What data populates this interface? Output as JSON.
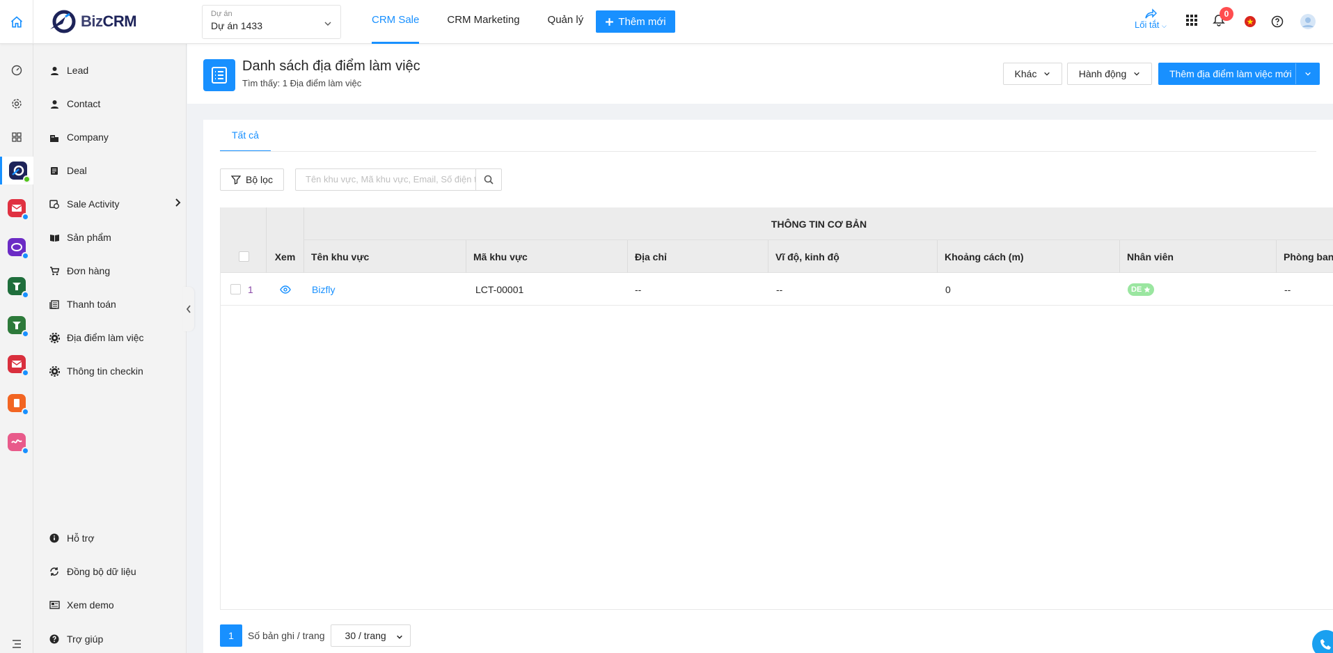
{
  "app": {
    "logo_prefix": "Biz",
    "logo_suffix": "CRM"
  },
  "project": {
    "label": "Dự án",
    "value": "Dự án 1433"
  },
  "topnav": {
    "tabs": [
      {
        "label": "CRM Sale",
        "active": true
      },
      {
        "label": "CRM Marketing",
        "active": false
      },
      {
        "label": "Quản lý",
        "active": false
      }
    ],
    "add_new_label": "Thêm mới",
    "shortcut_label": "Lối tắt",
    "notification_count": "0"
  },
  "sidebar": {
    "items": [
      {
        "label": "Lead",
        "icon": "user-icon"
      },
      {
        "label": "Contact",
        "icon": "user-icon"
      },
      {
        "label": "Company",
        "icon": "building-icon"
      },
      {
        "label": "Deal",
        "icon": "document-icon"
      },
      {
        "label": "Sale Activity",
        "icon": "calendar-clock-icon"
      },
      {
        "label": "Sản phẩm",
        "icon": "book-icon"
      },
      {
        "label": "Đơn hàng",
        "icon": "cart-icon"
      },
      {
        "label": "Thanh toán",
        "icon": "receipt-icon"
      },
      {
        "label": "Địa điểm làm việc",
        "icon": "gear-icon"
      },
      {
        "label": "Thông tin checkin",
        "icon": "gear-icon"
      }
    ],
    "bottom_items": [
      {
        "label": "Hỗ trợ",
        "icon": "info-icon"
      },
      {
        "label": "Đồng bộ dữ liệu",
        "icon": "sync-icon"
      },
      {
        "label": "Xem demo",
        "icon": "newspaper-icon"
      },
      {
        "label": "Trợ giúp",
        "icon": "help-icon"
      }
    ]
  },
  "page": {
    "title": "Danh sách địa điểm làm việc",
    "subtitle": "Tìm thấy: 1 Địa điểm làm việc",
    "btn_other": "Khác",
    "btn_action": "Hành động",
    "btn_add": "Thêm địa điểm làm việc mới"
  },
  "tabs": {
    "all": "Tất cả"
  },
  "filter": {
    "button": "Bộ lọc",
    "search_placeholder": "Tên khu vực, Mã khu vực, Email, Số điện thoại"
  },
  "table": {
    "group_header": "THÔNG TIN CƠ BẢN",
    "columns": [
      "Xem",
      "Tên khu vực",
      "Mã khu vực",
      "Địa chỉ",
      "Vĩ độ, kinh độ",
      "Khoảng cách (m)",
      "Nhân viên",
      "Phòng ban"
    ],
    "rows": [
      {
        "index": "1",
        "name": "Bizfly",
        "code": "LCT-00001",
        "address": "--",
        "latlng": "--",
        "distance": "0",
        "staff_tag": "DE",
        "department": "--"
      }
    ]
  },
  "pagination": {
    "current_page": "1",
    "records_label": "Số bản ghi / trang",
    "page_size": "30 / trang"
  },
  "colors": {
    "accent": "#1890ff",
    "badge": "#ff4d4f",
    "tag": "#9ae6a0"
  }
}
